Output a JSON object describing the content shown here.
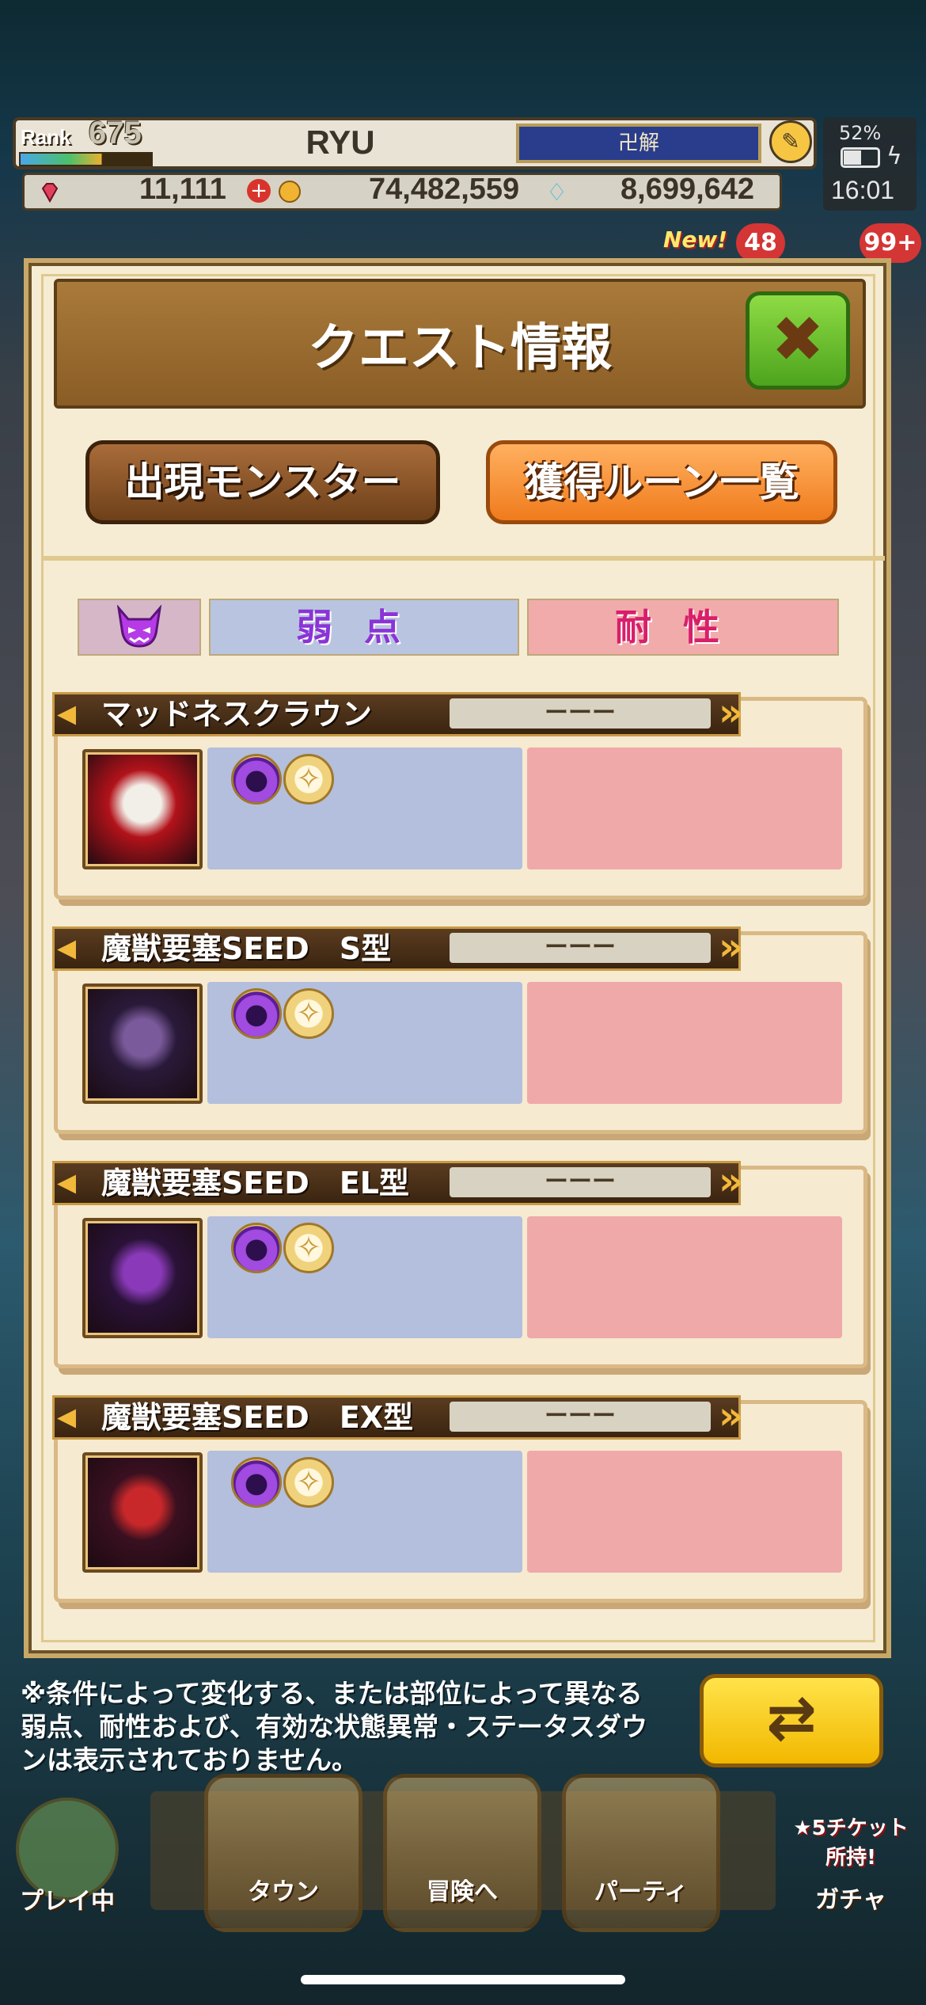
{
  "header": {
    "rank_label": "Rank",
    "rank_value": "675",
    "rank_progress": 0.62,
    "player_name": "RYU",
    "title_plate": "卍解",
    "gems": "11,111",
    "coins": "74,482,559",
    "drops": "8,699,642"
  },
  "device": {
    "battery": "52%",
    "time": "16:01"
  },
  "badges": {
    "new": "New!",
    "count_a": "48",
    "count_b": "99+"
  },
  "dialog": {
    "title": "クエスト情報",
    "tab_monster": "出現モンスター",
    "tab_rune": "獲得ルーン一覧",
    "col_weak": "弱点",
    "col_resist": "耐性"
  },
  "monsters": [
    {
      "name": "マッドネスクラウン",
      "status": "ーーー"
    },
    {
      "name": "魔獣要塞SEED　S型",
      "status": "ーーー"
    },
    {
      "name": "魔獣要塞SEED　EL型",
      "status": "ーーー"
    },
    {
      "name": "魔獣要塞SEED　EX型",
      "status": "ーーー"
    }
  ],
  "footnote": "※条件によって変化する、または部位によって異なる弱点、耐性および、有効な状態異常・ステータスダウンは表示されておりません。",
  "nav": {
    "play": "プレイ中",
    "town": "タウン",
    "adventure": "冒険へ",
    "party": "パーティ",
    "gacha": "ガチャ",
    "ticket_notice": "★5チケット所持!"
  },
  "colors": {
    "weak_bg": "#b4bfdd",
    "resist_bg": "#f0a9a9",
    "accent_green": "#4da41d",
    "accent_orange": "#f07b1c"
  }
}
